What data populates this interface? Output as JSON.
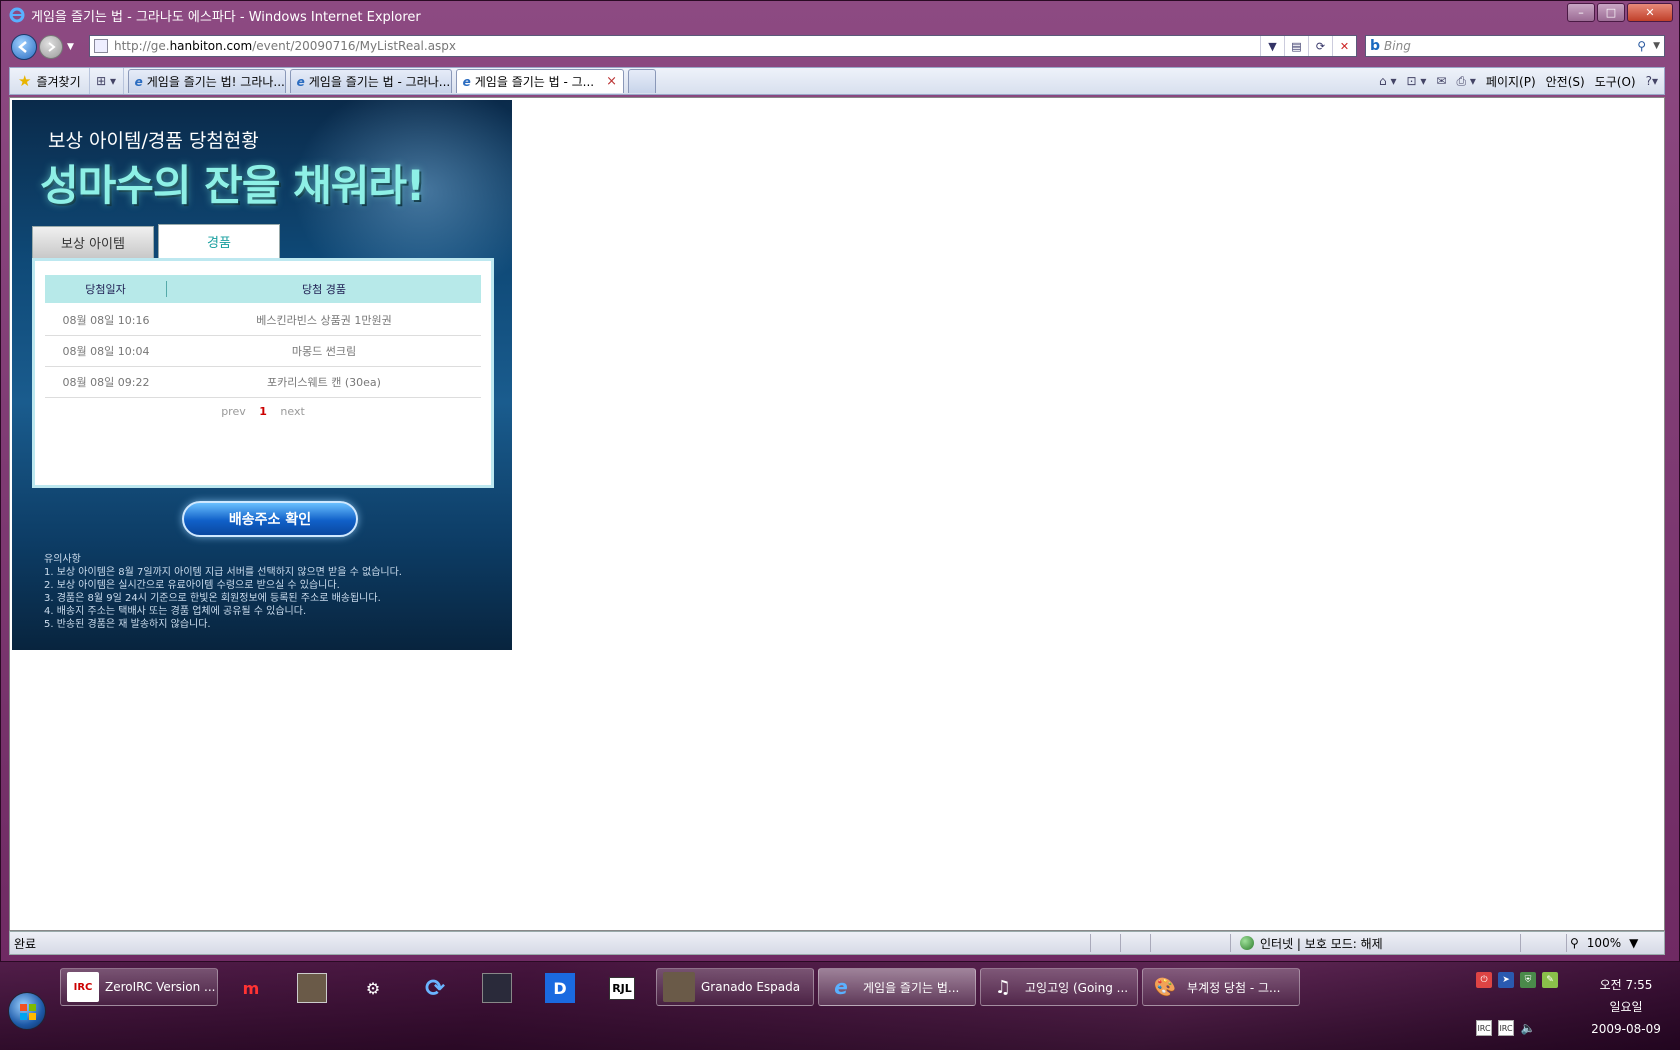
{
  "window": {
    "title": "게임을 즐기는 법 - 그라나도 에스파다 - Windows Internet Explorer",
    "controls": {
      "minimize": "–",
      "maximize": "□",
      "close": "✕"
    }
  },
  "address": {
    "prefix": "http://ge.",
    "domain": "hanbiton.com",
    "path": "/event/20090716/MyListReal.aspx"
  },
  "search": {
    "placeholder": "Bing"
  },
  "favorites": {
    "label": "즐겨찾기"
  },
  "tabs": [
    {
      "label": "게임을 즐기는 법! 그라나..."
    },
    {
      "label": "게임을 즐기는 법 - 그라나..."
    },
    {
      "label": "게임을 즐기는 법 - 그..."
    }
  ],
  "commandbar": {
    "page": "페이지(P)",
    "safety": "안전(S)",
    "tools": "도구(O)"
  },
  "event": {
    "subtitle": "보상 아이템/경품 당첨현황",
    "title": "성마수의 잔을 채워라!",
    "tab_items": "보상 아이템",
    "tab_prizes": "경품",
    "columns": [
      "당첨일자",
      "당첨 경품"
    ],
    "rows": [
      {
        "date": "08월 08일 10:16",
        "prize": "베스킨라빈스 상품권 1만원권"
      },
      {
        "date": "08월 08일 10:04",
        "prize": "마몽드 썬크림"
      },
      {
        "date": "08월 08일 09:22",
        "prize": "포카리스웨트 캔 (30ea)"
      }
    ],
    "pager": {
      "prev": "prev",
      "current": "1",
      "next": "next"
    },
    "button": "배송주소 확인",
    "notes_title": "유의사항",
    "notes": [
      "1. 보상 아이템은 8월 7일까지 아이템 지급 서버를 선택하지 않으면 받을 수 없습니다.",
      "2. 보상 아이템은 실시간으로 유료아이템 수령으로 받으실 수 있습니다.",
      "3. 경품은 8월 9일 24시 기준으로 한빛온 회원정보에 등록된 주소로 배송됩니다.",
      "4. 배송지 주소는 택배사 또는 경품 업체에 공유될 수 있습니다.",
      "5. 반송된 경품은 재 발송하지 않습니다."
    ]
  },
  "status": {
    "text": "완료",
    "zone": "인터넷 | 보호 모드: 해제",
    "zoom": "100%"
  },
  "taskbar": {
    "items": [
      {
        "label": "ZeroIRC Version ..."
      },
      {
        "label": "Granado Espada"
      },
      {
        "label": "게임을 즐기는 법..."
      },
      {
        "label": "고잉고잉 (Going ..."
      },
      {
        "label": "부계정 당첨 - 그..."
      }
    ],
    "pinned_d": "D",
    "pinned_rjl": "RJL",
    "clock": {
      "time": "오전 7:55",
      "day": "일요일",
      "date": "2009-08-09"
    }
  }
}
